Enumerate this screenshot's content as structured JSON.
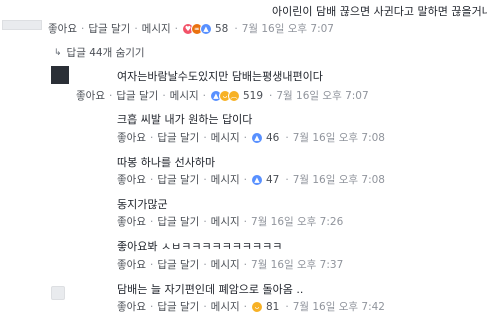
{
  "top_comment": {
    "text": "아이린이 담배 끊으면 사귄다고 말하면 끊을거냐",
    "meta": {
      "like": "좋아요",
      "reply": "답글 달기",
      "message": "메시지",
      "count": "58",
      "time": "7월 16일 오후 7:07"
    }
  },
  "replies_toggle": {
    "label": "답글 44개 숨기기"
  },
  "replies": [
    {
      "text": "여자는바람날수도있지만 담배는평생내편이다",
      "meta": {
        "like": "좋아요",
        "reply": "답글 달기",
        "message": "메시지",
        "count": "519",
        "time": "7월 16일 오후 7:07"
      }
    },
    {
      "text": "크흡 씨발 내가 원하는 답이다",
      "meta": {
        "like": "좋아요",
        "reply": "답글 달기",
        "message": "메시지",
        "count": "46",
        "time": "7월 16일 오후 7:08"
      }
    },
    {
      "text": "따봉 하나를 선사하마",
      "meta": {
        "like": "좋아요",
        "reply": "답글 달기",
        "message": "메시지",
        "count": "47",
        "time": "7월 16일 오후 7:08"
      }
    },
    {
      "text": "동지가많군",
      "meta": {
        "like": "좋아요",
        "reply": "답글 달기",
        "message": "메시지",
        "time": "7월 16일 오후 7:26"
      }
    },
    {
      "text": "좋아요봐 ㅅㅂㅋㅋㅋㅋㅋㅋㅋㅋㅋㅋ",
      "meta": {
        "like": "좋아요",
        "reply": "답글 달기",
        "message": "메시지",
        "time": "7월 16일 오후 7:37"
      }
    },
    {
      "text": "담배는 늘 자기편인데 폐암으로 돌아옴 ..",
      "meta": {
        "like": "좋아요",
        "reply": "답글 달기",
        "message": "메시지",
        "count": "81",
        "time": "7월 16일 오후 7:42"
      }
    }
  ],
  "colors": {
    "text": "#1d2129",
    "meta": "#90949c",
    "link": "#4b4f56",
    "like_blue": "#5890ff",
    "haha_yellow": "#f7b125",
    "angry_orange": "#e9710f"
  },
  "icons": {
    "replies_toggle": "reply-arrow-icon",
    "reactions": [
      "like-icon",
      "haha-icon",
      "angry-icon",
      "sad-icon"
    ]
  }
}
